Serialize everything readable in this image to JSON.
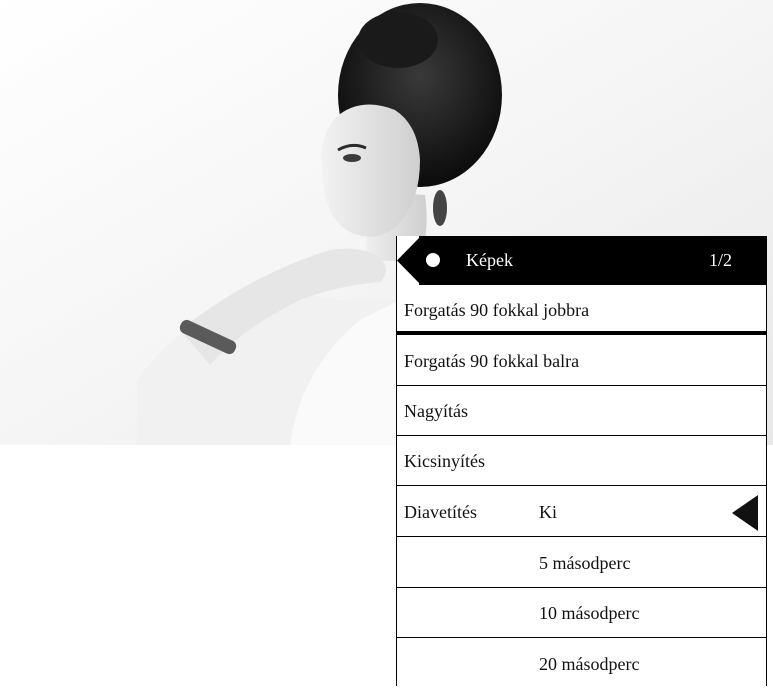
{
  "menu": {
    "header": {
      "title": "Képek",
      "page_indicator": "1/2",
      "back_icon": "back-arrow-icon"
    },
    "items": [
      {
        "label": "Forgatás 90 fokkal jobbra",
        "selected": true
      },
      {
        "label": "Forgatás 90 fokkal balra"
      },
      {
        "label": "Nagyítás"
      },
      {
        "label": "Kicsinyítés"
      }
    ],
    "slideshow": {
      "label": "Diavetítés",
      "options": [
        "Ki",
        "5 másodperc",
        "10 másodperc",
        "20 másodperc"
      ],
      "selected": "Ki",
      "indicator_icon": "left-triangle-icon"
    }
  },
  "colors": {
    "header_bg": "#000000",
    "header_text": "#ffffff",
    "text": "#111111",
    "divider": "#000000"
  }
}
